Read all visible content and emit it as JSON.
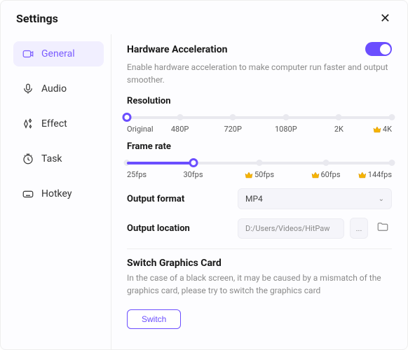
{
  "title": "Settings",
  "sidebar": {
    "items": [
      {
        "label": "General",
        "active": true
      },
      {
        "label": "Audio"
      },
      {
        "label": "Effect"
      },
      {
        "label": "Task"
      },
      {
        "label": "Hotkey"
      }
    ]
  },
  "hwaccel": {
    "title": "Hardware Acceleration",
    "desc": "Enable hardware acceleration to make computer run faster and output smoother.",
    "enabled": true
  },
  "resolution": {
    "label": "Resolution",
    "options": [
      "Original",
      "480P",
      "720P",
      "1080P",
      "2K",
      "4K"
    ],
    "premium": [
      false,
      false,
      false,
      false,
      false,
      true
    ],
    "value_index": 0
  },
  "framerate": {
    "label": "Frame rate",
    "options": [
      "25fps",
      "30fps",
      "50fps",
      "60fps",
      "144fps"
    ],
    "premium": [
      false,
      false,
      true,
      true,
      true
    ],
    "value_index": 1
  },
  "output_format": {
    "label": "Output format",
    "value": "MP4"
  },
  "output_location": {
    "label": "Output location",
    "value": "D:/Users/Videos/HitPaw",
    "more": "..."
  },
  "switch_card": {
    "title": "Switch Graphics Card",
    "desc": "In the case of a black screen, it may be caused by a mismatch of the graphics card, please try to switch the graphics card",
    "button": "Switch"
  },
  "colors": {
    "accent": "#6b4eff"
  }
}
